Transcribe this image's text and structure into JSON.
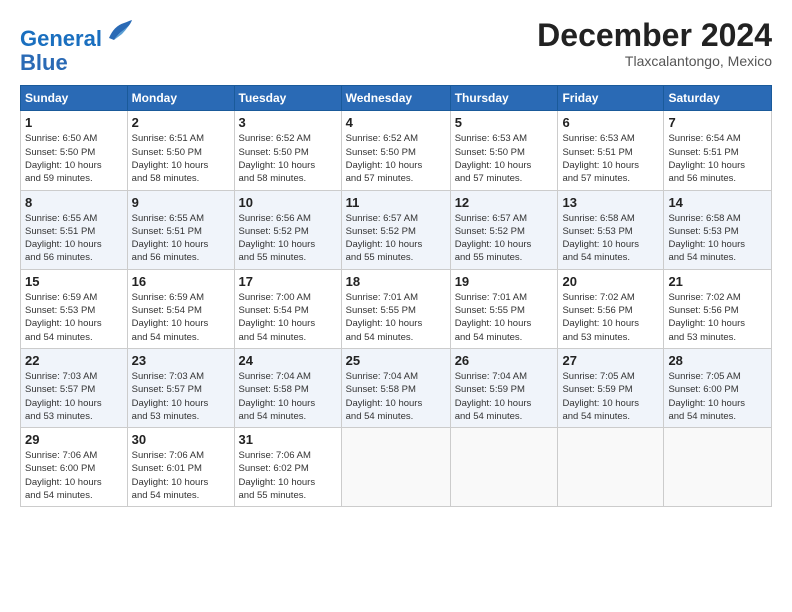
{
  "logo": {
    "line1": "General",
    "line2": "Blue"
  },
  "title": "December 2024",
  "subtitle": "Tlaxcalantongo, Mexico",
  "days_of_week": [
    "Sunday",
    "Monday",
    "Tuesday",
    "Wednesday",
    "Thursday",
    "Friday",
    "Saturday"
  ],
  "weeks": [
    [
      {
        "day": "1",
        "info": "Sunrise: 6:50 AM\nSunset: 5:50 PM\nDaylight: 10 hours\nand 59 minutes."
      },
      {
        "day": "2",
        "info": "Sunrise: 6:51 AM\nSunset: 5:50 PM\nDaylight: 10 hours\nand 58 minutes."
      },
      {
        "day": "3",
        "info": "Sunrise: 6:52 AM\nSunset: 5:50 PM\nDaylight: 10 hours\nand 58 minutes."
      },
      {
        "day": "4",
        "info": "Sunrise: 6:52 AM\nSunset: 5:50 PM\nDaylight: 10 hours\nand 57 minutes."
      },
      {
        "day": "5",
        "info": "Sunrise: 6:53 AM\nSunset: 5:50 PM\nDaylight: 10 hours\nand 57 minutes."
      },
      {
        "day": "6",
        "info": "Sunrise: 6:53 AM\nSunset: 5:51 PM\nDaylight: 10 hours\nand 57 minutes."
      },
      {
        "day": "7",
        "info": "Sunrise: 6:54 AM\nSunset: 5:51 PM\nDaylight: 10 hours\nand 56 minutes."
      }
    ],
    [
      {
        "day": "8",
        "info": "Sunrise: 6:55 AM\nSunset: 5:51 PM\nDaylight: 10 hours\nand 56 minutes."
      },
      {
        "day": "9",
        "info": "Sunrise: 6:55 AM\nSunset: 5:51 PM\nDaylight: 10 hours\nand 56 minutes."
      },
      {
        "day": "10",
        "info": "Sunrise: 6:56 AM\nSunset: 5:52 PM\nDaylight: 10 hours\nand 55 minutes."
      },
      {
        "day": "11",
        "info": "Sunrise: 6:57 AM\nSunset: 5:52 PM\nDaylight: 10 hours\nand 55 minutes."
      },
      {
        "day": "12",
        "info": "Sunrise: 6:57 AM\nSunset: 5:52 PM\nDaylight: 10 hours\nand 55 minutes."
      },
      {
        "day": "13",
        "info": "Sunrise: 6:58 AM\nSunset: 5:53 PM\nDaylight: 10 hours\nand 54 minutes."
      },
      {
        "day": "14",
        "info": "Sunrise: 6:58 AM\nSunset: 5:53 PM\nDaylight: 10 hours\nand 54 minutes."
      }
    ],
    [
      {
        "day": "15",
        "info": "Sunrise: 6:59 AM\nSunset: 5:53 PM\nDaylight: 10 hours\nand 54 minutes."
      },
      {
        "day": "16",
        "info": "Sunrise: 6:59 AM\nSunset: 5:54 PM\nDaylight: 10 hours\nand 54 minutes."
      },
      {
        "day": "17",
        "info": "Sunrise: 7:00 AM\nSunset: 5:54 PM\nDaylight: 10 hours\nand 54 minutes."
      },
      {
        "day": "18",
        "info": "Sunrise: 7:01 AM\nSunset: 5:55 PM\nDaylight: 10 hours\nand 54 minutes."
      },
      {
        "day": "19",
        "info": "Sunrise: 7:01 AM\nSunset: 5:55 PM\nDaylight: 10 hours\nand 54 minutes."
      },
      {
        "day": "20",
        "info": "Sunrise: 7:02 AM\nSunset: 5:56 PM\nDaylight: 10 hours\nand 53 minutes."
      },
      {
        "day": "21",
        "info": "Sunrise: 7:02 AM\nSunset: 5:56 PM\nDaylight: 10 hours\nand 53 minutes."
      }
    ],
    [
      {
        "day": "22",
        "info": "Sunrise: 7:03 AM\nSunset: 5:57 PM\nDaylight: 10 hours\nand 53 minutes."
      },
      {
        "day": "23",
        "info": "Sunrise: 7:03 AM\nSunset: 5:57 PM\nDaylight: 10 hours\nand 53 minutes."
      },
      {
        "day": "24",
        "info": "Sunrise: 7:04 AM\nSunset: 5:58 PM\nDaylight: 10 hours\nand 54 minutes."
      },
      {
        "day": "25",
        "info": "Sunrise: 7:04 AM\nSunset: 5:58 PM\nDaylight: 10 hours\nand 54 minutes."
      },
      {
        "day": "26",
        "info": "Sunrise: 7:04 AM\nSunset: 5:59 PM\nDaylight: 10 hours\nand 54 minutes."
      },
      {
        "day": "27",
        "info": "Sunrise: 7:05 AM\nSunset: 5:59 PM\nDaylight: 10 hours\nand 54 minutes."
      },
      {
        "day": "28",
        "info": "Sunrise: 7:05 AM\nSunset: 6:00 PM\nDaylight: 10 hours\nand 54 minutes."
      }
    ],
    [
      {
        "day": "29",
        "info": "Sunrise: 7:06 AM\nSunset: 6:00 PM\nDaylight: 10 hours\nand 54 minutes."
      },
      {
        "day": "30",
        "info": "Sunrise: 7:06 AM\nSunset: 6:01 PM\nDaylight: 10 hours\nand 54 minutes."
      },
      {
        "day": "31",
        "info": "Sunrise: 7:06 AM\nSunset: 6:02 PM\nDaylight: 10 hours\nand 55 minutes."
      },
      {
        "day": "",
        "info": ""
      },
      {
        "day": "",
        "info": ""
      },
      {
        "day": "",
        "info": ""
      },
      {
        "day": "",
        "info": ""
      }
    ]
  ]
}
